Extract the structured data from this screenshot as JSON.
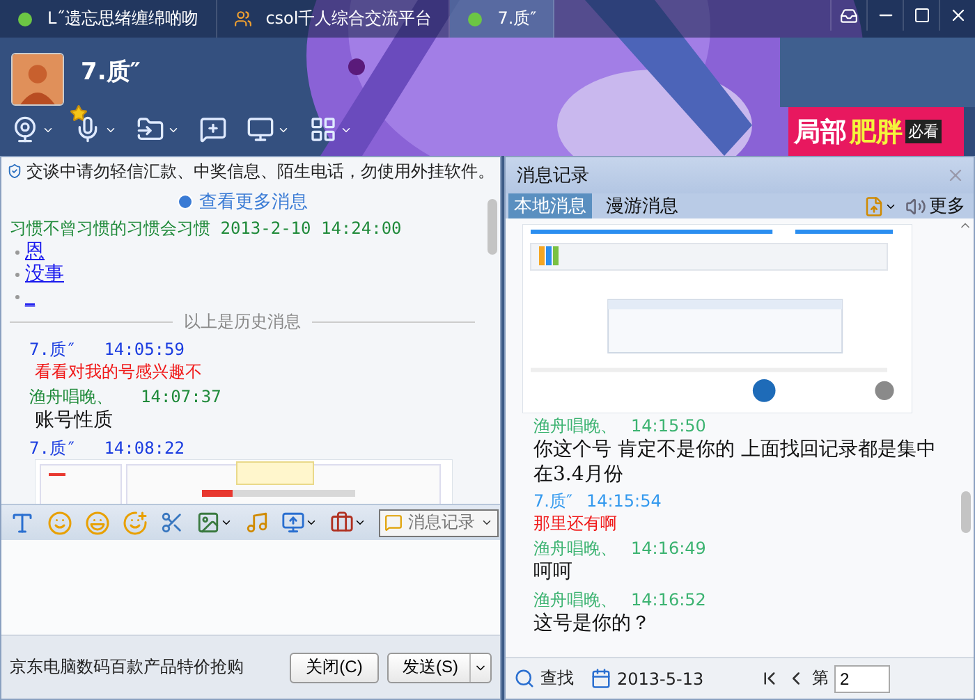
{
  "window": {
    "tabs": [
      {
        "label": "L˝遗忘思绪缠绵啲吻",
        "kind": "online",
        "selected": false
      },
      {
        "label": "csol千人综合交流平台",
        "kind": "group",
        "selected": false
      },
      {
        "label": "7.质″",
        "kind": "online",
        "selected": true
      }
    ]
  },
  "contact": {
    "name": "7.质″",
    "starred": true
  },
  "ad_banner": {
    "parts": [
      {
        "text": "局部",
        "color": "#ffffff"
      },
      {
        "text": "肥胖",
        "color": "#f4f43c"
      }
    ],
    "tag": "必看"
  },
  "chat": {
    "notice": "交谈中请勿轻信汇款、中奖信息、陌生电话，勿使用外挂软件。",
    "more_link": "查看更多消息",
    "history": {
      "sender": "习惯不曾习惯的习惯会习惯",
      "time": "2013-2-10 14:24:00",
      "items": [
        "恩",
        "没事",
        "_"
      ]
    },
    "divider": "以上是历史消息",
    "messages": [
      {
        "sender": "7.质″",
        "time": "14:05:59",
        "color": "#1a3ce0",
        "kind": "sent",
        "text": "看看对我的号感兴趣不"
      },
      {
        "sender": "渔舟唱晚、",
        "time": "14:07:37",
        "color": "#1f8a3a",
        "kind": "received",
        "text": "账号性质"
      },
      {
        "sender": "7.质″",
        "time": "14:08:22",
        "color": "#1a3ce0",
        "kind": "picture"
      }
    ]
  },
  "input_toolbar": {
    "history_button": "消息记录"
  },
  "footer": {
    "ad": "京东电脑数码百款产品特价抢购",
    "buttons": [
      {
        "label": "关闭(C)",
        "kind": "plain"
      },
      {
        "label": "发送(S)",
        "kind": "split"
      }
    ]
  },
  "history_panel": {
    "title": "消息记录",
    "tabs": [
      {
        "label": "本地消息",
        "selected": true
      },
      {
        "label": "漫游消息",
        "selected": false
      }
    ],
    "more": "更多",
    "messages": [
      {
        "kind": "picture"
      },
      {
        "sender": "渔舟唱晚、",
        "time": "14:15:50",
        "color": "#3cb371",
        "kind": "received",
        "text": "你这个号 肯定不是你的 上面找回记录都是集中在3.4月份"
      },
      {
        "sender": "7.质″",
        "time": "14:15:54",
        "color": "#3399ee",
        "kind": "sent",
        "text": "那里还有啊"
      },
      {
        "sender": "渔舟唱晚、",
        "time": "14:16:49",
        "color": "#3cb371",
        "kind": "received",
        "text": "呵呵"
      },
      {
        "sender": "渔舟唱晚、",
        "time": "14:16:52",
        "color": "#3cb371",
        "kind": "received",
        "text": "这号是你的？"
      }
    ],
    "search": "查找",
    "date": "2013-5-13",
    "page_label": "第",
    "page": "2"
  }
}
